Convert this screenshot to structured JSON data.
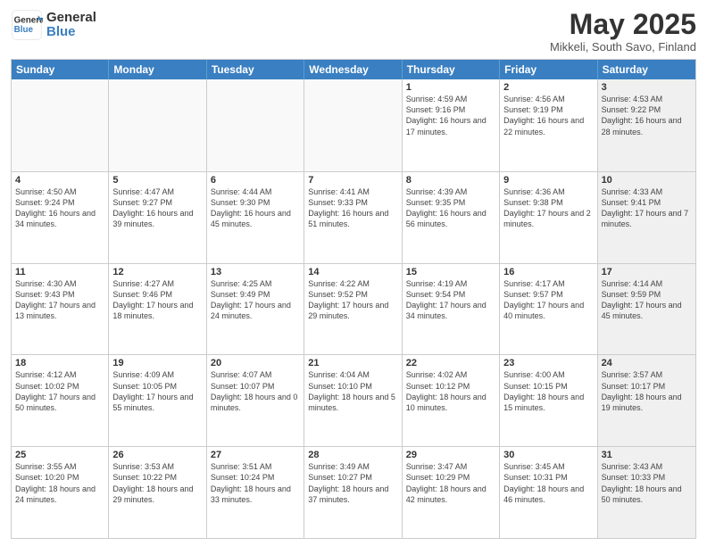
{
  "header": {
    "logo_general": "General",
    "logo_blue": "Blue",
    "month_title": "May 2025",
    "location": "Mikkeli, South Savo, Finland"
  },
  "weekdays": [
    "Sunday",
    "Monday",
    "Tuesday",
    "Wednesday",
    "Thursday",
    "Friday",
    "Saturday"
  ],
  "weeks": [
    [
      {
        "day": "",
        "info": "",
        "empty": true
      },
      {
        "day": "",
        "info": "",
        "empty": true
      },
      {
        "day": "",
        "info": "",
        "empty": true
      },
      {
        "day": "",
        "info": "",
        "empty": true
      },
      {
        "day": "1",
        "info": "Sunrise: 4:59 AM\nSunset: 9:16 PM\nDaylight: 16 hours\nand 17 minutes.",
        "empty": false
      },
      {
        "day": "2",
        "info": "Sunrise: 4:56 AM\nSunset: 9:19 PM\nDaylight: 16 hours\nand 22 minutes.",
        "empty": false
      },
      {
        "day": "3",
        "info": "Sunrise: 4:53 AM\nSunset: 9:22 PM\nDaylight: 16 hours\nand 28 minutes.",
        "empty": false,
        "shaded": true
      }
    ],
    [
      {
        "day": "4",
        "info": "Sunrise: 4:50 AM\nSunset: 9:24 PM\nDaylight: 16 hours\nand 34 minutes.",
        "empty": false
      },
      {
        "day": "5",
        "info": "Sunrise: 4:47 AM\nSunset: 9:27 PM\nDaylight: 16 hours\nand 39 minutes.",
        "empty": false
      },
      {
        "day": "6",
        "info": "Sunrise: 4:44 AM\nSunset: 9:30 PM\nDaylight: 16 hours\nand 45 minutes.",
        "empty": false
      },
      {
        "day": "7",
        "info": "Sunrise: 4:41 AM\nSunset: 9:33 PM\nDaylight: 16 hours\nand 51 minutes.",
        "empty": false
      },
      {
        "day": "8",
        "info": "Sunrise: 4:39 AM\nSunset: 9:35 PM\nDaylight: 16 hours\nand 56 minutes.",
        "empty": false
      },
      {
        "day": "9",
        "info": "Sunrise: 4:36 AM\nSunset: 9:38 PM\nDaylight: 17 hours\nand 2 minutes.",
        "empty": false
      },
      {
        "day": "10",
        "info": "Sunrise: 4:33 AM\nSunset: 9:41 PM\nDaylight: 17 hours\nand 7 minutes.",
        "empty": false,
        "shaded": true
      }
    ],
    [
      {
        "day": "11",
        "info": "Sunrise: 4:30 AM\nSunset: 9:43 PM\nDaylight: 17 hours\nand 13 minutes.",
        "empty": false
      },
      {
        "day": "12",
        "info": "Sunrise: 4:27 AM\nSunset: 9:46 PM\nDaylight: 17 hours\nand 18 minutes.",
        "empty": false
      },
      {
        "day": "13",
        "info": "Sunrise: 4:25 AM\nSunset: 9:49 PM\nDaylight: 17 hours\nand 24 minutes.",
        "empty": false
      },
      {
        "day": "14",
        "info": "Sunrise: 4:22 AM\nSunset: 9:52 PM\nDaylight: 17 hours\nand 29 minutes.",
        "empty": false
      },
      {
        "day": "15",
        "info": "Sunrise: 4:19 AM\nSunset: 9:54 PM\nDaylight: 17 hours\nand 34 minutes.",
        "empty": false
      },
      {
        "day": "16",
        "info": "Sunrise: 4:17 AM\nSunset: 9:57 PM\nDaylight: 17 hours\nand 40 minutes.",
        "empty": false
      },
      {
        "day": "17",
        "info": "Sunrise: 4:14 AM\nSunset: 9:59 PM\nDaylight: 17 hours\nand 45 minutes.",
        "empty": false,
        "shaded": true
      }
    ],
    [
      {
        "day": "18",
        "info": "Sunrise: 4:12 AM\nSunset: 10:02 PM\nDaylight: 17 hours\nand 50 minutes.",
        "empty": false
      },
      {
        "day": "19",
        "info": "Sunrise: 4:09 AM\nSunset: 10:05 PM\nDaylight: 17 hours\nand 55 minutes.",
        "empty": false
      },
      {
        "day": "20",
        "info": "Sunrise: 4:07 AM\nSunset: 10:07 PM\nDaylight: 18 hours\nand 0 minutes.",
        "empty": false
      },
      {
        "day": "21",
        "info": "Sunrise: 4:04 AM\nSunset: 10:10 PM\nDaylight: 18 hours\nand 5 minutes.",
        "empty": false
      },
      {
        "day": "22",
        "info": "Sunrise: 4:02 AM\nSunset: 10:12 PM\nDaylight: 18 hours\nand 10 minutes.",
        "empty": false
      },
      {
        "day": "23",
        "info": "Sunrise: 4:00 AM\nSunset: 10:15 PM\nDaylight: 18 hours\nand 15 minutes.",
        "empty": false
      },
      {
        "day": "24",
        "info": "Sunrise: 3:57 AM\nSunset: 10:17 PM\nDaylight: 18 hours\nand 19 minutes.",
        "empty": false,
        "shaded": true
      }
    ],
    [
      {
        "day": "25",
        "info": "Sunrise: 3:55 AM\nSunset: 10:20 PM\nDaylight: 18 hours\nand 24 minutes.",
        "empty": false
      },
      {
        "day": "26",
        "info": "Sunrise: 3:53 AM\nSunset: 10:22 PM\nDaylight: 18 hours\nand 29 minutes.",
        "empty": false
      },
      {
        "day": "27",
        "info": "Sunrise: 3:51 AM\nSunset: 10:24 PM\nDaylight: 18 hours\nand 33 minutes.",
        "empty": false
      },
      {
        "day": "28",
        "info": "Sunrise: 3:49 AM\nSunset: 10:27 PM\nDaylight: 18 hours\nand 37 minutes.",
        "empty": false
      },
      {
        "day": "29",
        "info": "Sunrise: 3:47 AM\nSunset: 10:29 PM\nDaylight: 18 hours\nand 42 minutes.",
        "empty": false
      },
      {
        "day": "30",
        "info": "Sunrise: 3:45 AM\nSunset: 10:31 PM\nDaylight: 18 hours\nand 46 minutes.",
        "empty": false
      },
      {
        "day": "31",
        "info": "Sunrise: 3:43 AM\nSunset: 10:33 PM\nDaylight: 18 hours\nand 50 minutes.",
        "empty": false,
        "shaded": true
      }
    ]
  ]
}
